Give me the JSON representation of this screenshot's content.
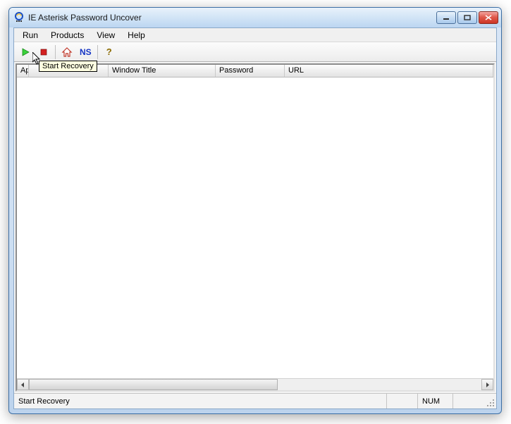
{
  "title": "IE Asterisk Password Uncover",
  "menu": {
    "run": "Run",
    "products": "Products",
    "view": "View",
    "help": "Help"
  },
  "toolbar": {
    "start_tooltip": "Start Recovery",
    "ns_label": "NS",
    "help_label": "?"
  },
  "columns": {
    "application": "Application",
    "window_title": "Window Title",
    "password": "Password",
    "url": "URL"
  },
  "status": {
    "text": "Start Recovery",
    "num": "NUM"
  }
}
